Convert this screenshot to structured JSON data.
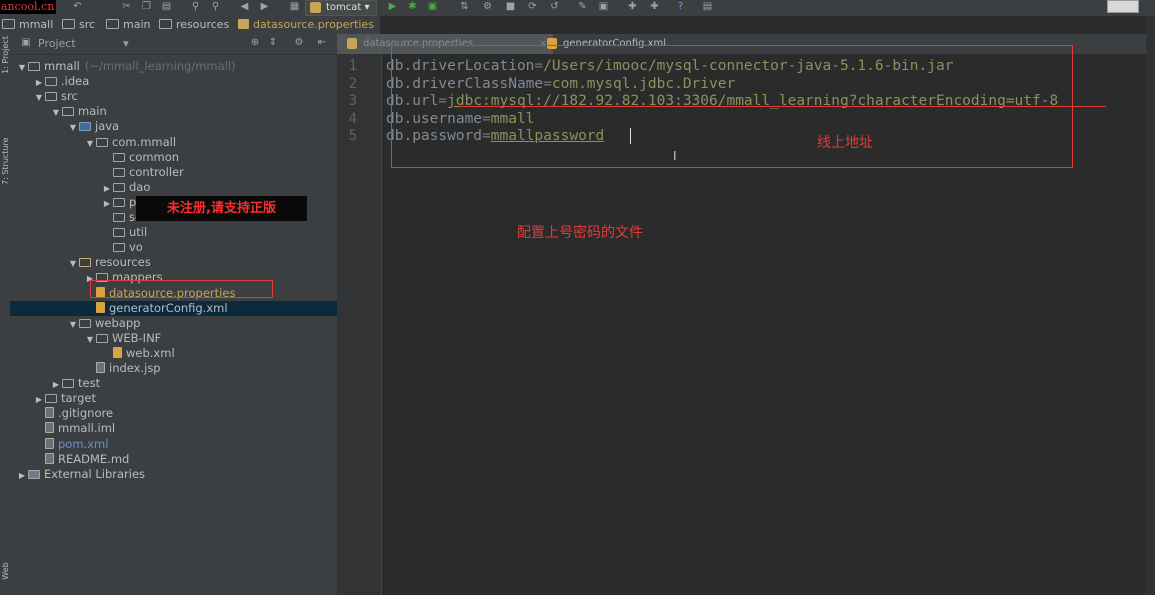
{
  "toolbar": {
    "watermark": "ancool.cn",
    "run_config": "tomcat",
    "icons": [
      "undo-icon",
      "cut-icon",
      "copy-icon",
      "paste-icon",
      "find-icon",
      "replace-icon",
      "back-icon",
      "forward-icon",
      "build-icon",
      "run-icon",
      "debug-icon",
      "coverage-icon",
      "stop-icon",
      "vcs-icon",
      "settings-icon",
      "structure-icon",
      "sync-icon",
      "help-icon",
      "sdk-icon"
    ]
  },
  "breadcrumb": [
    "mmall",
    "src",
    "main",
    "resources",
    "datasource.properties"
  ],
  "left_stripe": {
    "project": "1: Project",
    "structure": "7: Structure",
    "web": "Web"
  },
  "project_panel": {
    "title": "Project",
    "dropdown": "▾",
    "tree": [
      {
        "label": "mmall",
        "suffix": "(~/mmall_learning/mmall)",
        "depth": 0,
        "arrow": "▼",
        "icon": "folder"
      },
      {
        "label": ".idea",
        "depth": 1,
        "arrow": "▶",
        "icon": "folder"
      },
      {
        "label": "src",
        "depth": 1,
        "arrow": "▼",
        "icon": "folder"
      },
      {
        "label": "main",
        "depth": 2,
        "arrow": "▼",
        "icon": "folder"
      },
      {
        "label": "java",
        "depth": 3,
        "arrow": "▼",
        "icon": "src"
      },
      {
        "label": "com.mmall",
        "depth": 4,
        "arrow": "▼",
        "icon": "folder"
      },
      {
        "label": "common",
        "depth": 5,
        "arrow": "",
        "icon": "folder"
      },
      {
        "label": "controller",
        "depth": 5,
        "arrow": "",
        "icon": "folder"
      },
      {
        "label": "dao",
        "depth": 5,
        "arrow": "▶",
        "icon": "folder"
      },
      {
        "label": "pojo",
        "depth": 5,
        "arrow": "▶",
        "icon": "folder"
      },
      {
        "label": "service",
        "depth": 5,
        "arrow": "",
        "icon": "folder"
      },
      {
        "label": "util",
        "depth": 5,
        "arrow": "",
        "icon": "folder"
      },
      {
        "label": "vo",
        "depth": 5,
        "arrow": "",
        "icon": "folder"
      },
      {
        "label": "resources",
        "depth": 3,
        "arrow": "▼",
        "icon": "res"
      },
      {
        "label": "mappers",
        "depth": 4,
        "arrow": "▶",
        "icon": "folder"
      },
      {
        "label": "datasource.properties",
        "depth": 4,
        "arrow": "",
        "icon": "props",
        "cls": "props"
      },
      {
        "label": "generatorConfig.xml",
        "depth": 4,
        "arrow": "",
        "icon": "xml",
        "selected": true
      },
      {
        "label": "webapp",
        "depth": 3,
        "arrow": "▼",
        "icon": "folder"
      },
      {
        "label": "WEB-INF",
        "depth": 4,
        "arrow": "▼",
        "icon": "folder"
      },
      {
        "label": "web.xml",
        "depth": 5,
        "arrow": "",
        "icon": "xml"
      },
      {
        "label": "index.jsp",
        "depth": 4,
        "arrow": "",
        "icon": "file"
      },
      {
        "label": "test",
        "depth": 2,
        "arrow": "▶",
        "icon": "folder"
      },
      {
        "label": "target",
        "depth": 1,
        "arrow": "▶",
        "icon": "folder"
      },
      {
        "label": ".gitignore",
        "depth": 1,
        "arrow": "",
        "icon": "file"
      },
      {
        "label": "mmall.iml",
        "depth": 1,
        "arrow": "",
        "icon": "file"
      },
      {
        "label": "pom.xml",
        "depth": 1,
        "arrow": "",
        "icon": "file",
        "cls": "pom"
      },
      {
        "label": "README.md",
        "depth": 1,
        "arrow": "",
        "icon": "file"
      },
      {
        "label": "External Libraries",
        "depth": 0,
        "arrow": "▶",
        "icon": "lib"
      }
    ]
  },
  "editor": {
    "tabs": [
      {
        "label": "datasource.properties",
        "active": true,
        "close": "×"
      },
      {
        "label": "generatorConfig.xml",
        "active": false,
        "close": "×"
      }
    ],
    "lines": [
      {
        "num": "1",
        "key": "db.driverLocation",
        "eq": "=",
        "value": "/Users/imooc/mysql-connector-java-5.1.6-bin.jar"
      },
      {
        "num": "2",
        "key": "db.driverClassName",
        "eq": "=",
        "value": "com.mysql.jdbc.Driver"
      },
      {
        "num": "3",
        "key": "db.url",
        "eq": "=",
        "value": "jdbc:mysql://182.92.82.103:3306/mmall_learning?characterEncoding=utf-8"
      },
      {
        "num": "4",
        "key": "db.username",
        "eq": "=",
        "value": "mmall"
      },
      {
        "num": "5",
        "key": "db.password",
        "eq": "=",
        "value": "mmallpassword"
      }
    ]
  },
  "annotations": {
    "online_address": "线上地址",
    "config_note": "配置上号密码的文件",
    "unregistered_banner": "未注册,请支持正版"
  },
  "colors": {
    "annotation_red": "#e03a3a",
    "background": "#2b2b2b",
    "panel": "#3c3f41"
  }
}
